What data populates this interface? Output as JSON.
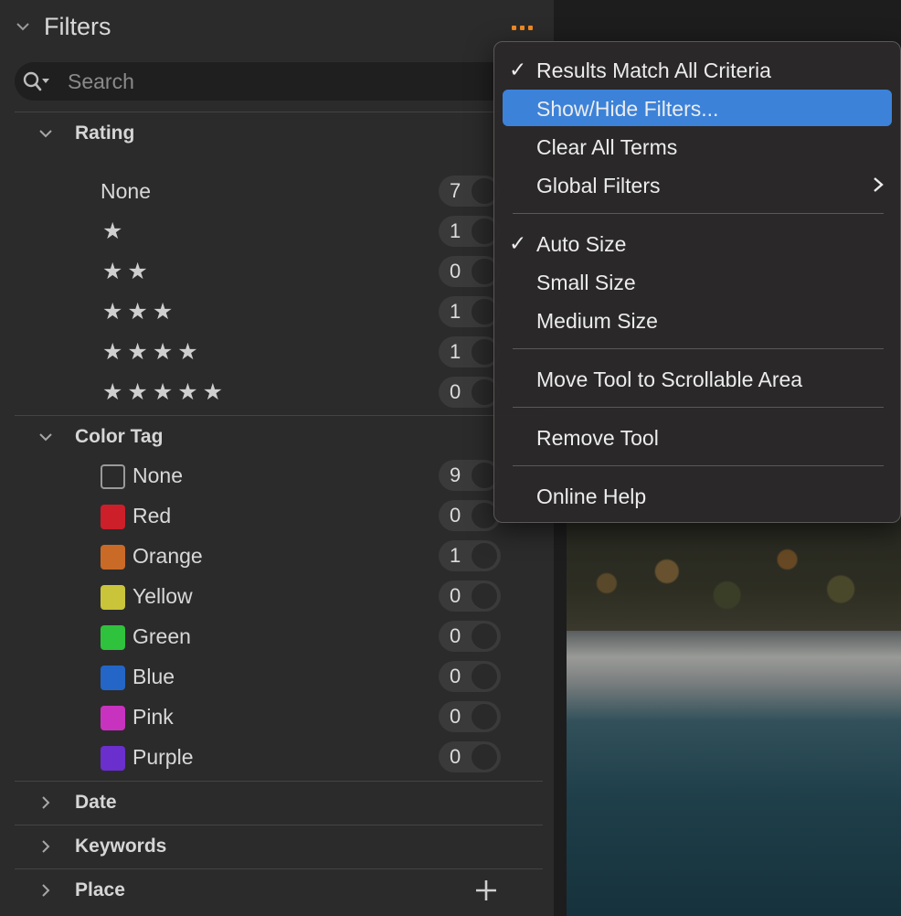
{
  "panel": {
    "title": "Filters",
    "search_placeholder": "Search"
  },
  "sections": {
    "rating": {
      "title": "Rating",
      "rows": [
        {
          "label": "None",
          "count": "7"
        },
        {
          "stars": "★",
          "count": "1"
        },
        {
          "stars": "★★",
          "count": "0"
        },
        {
          "stars": "★★★",
          "count": "1"
        },
        {
          "stars": "★★★★",
          "count": "1"
        },
        {
          "stars": "★★★★★",
          "count": "0"
        }
      ]
    },
    "color_tag": {
      "title": "Color Tag",
      "rows": [
        {
          "label": "None",
          "count": "9",
          "color": "none"
        },
        {
          "label": "Red",
          "count": "0",
          "color": "#cc1f2a"
        },
        {
          "label": "Orange",
          "count": "1",
          "color": "#c96a27"
        },
        {
          "label": "Yellow",
          "count": "0",
          "color": "#c9c43a"
        },
        {
          "label": "Green",
          "count": "0",
          "color": "#2fc23c"
        },
        {
          "label": "Blue",
          "count": "0",
          "color": "#2366c8"
        },
        {
          "label": "Pink",
          "count": "0",
          "color": "#c733be"
        },
        {
          "label": "Purple",
          "count": "0",
          "color": "#6a2fcc"
        }
      ]
    },
    "date": {
      "title": "Date"
    },
    "keywords": {
      "title": "Keywords"
    },
    "place": {
      "title": "Place"
    }
  },
  "menu": {
    "items": [
      {
        "label": "Results Match All Criteria",
        "checked": true
      },
      {
        "label": "Show/Hide Filters...",
        "highlighted": true
      },
      {
        "label": "Clear All Terms"
      },
      {
        "label": "Global Filters",
        "submenu": true
      },
      {
        "label": "Auto Size",
        "checked": true
      },
      {
        "label": "Small Size"
      },
      {
        "label": "Medium Size"
      },
      {
        "label": "Move Tool to Scrollable Area"
      },
      {
        "label": "Remove Tool"
      },
      {
        "label": "Online Help"
      }
    ],
    "check_glyph": "✓"
  },
  "colors": {
    "accent_orange": "#f08a24",
    "menu_highlight": "#3c82d9"
  }
}
